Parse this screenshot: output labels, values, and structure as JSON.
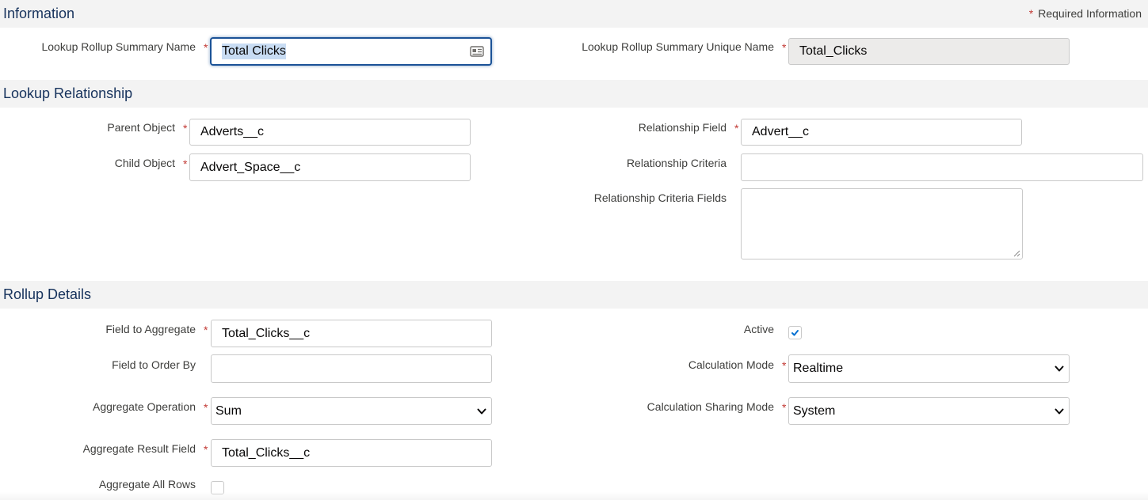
{
  "sections": {
    "information": {
      "title": "Information",
      "required_note": "Required Information",
      "required_star": "*"
    },
    "lookup_relationship": {
      "title": "Lookup Relationship"
    },
    "rollup_details": {
      "title": "Rollup Details"
    }
  },
  "fields": {
    "summary_name": {
      "label": "Lookup Rollup Summary Name",
      "value": "Total Clicks",
      "required": true
    },
    "unique_name": {
      "label": "Lookup Rollup Summary Unique Name",
      "value": "Total_Clicks",
      "required": true
    },
    "parent_object": {
      "label": "Parent Object",
      "value": "Adverts__c",
      "required": true
    },
    "child_object": {
      "label": "Child Object",
      "value": "Advert_Space__c",
      "required": true
    },
    "relationship_field": {
      "label": "Relationship Field",
      "value": "Advert__c",
      "required": true
    },
    "relationship_criteria": {
      "label": "Relationship Criteria",
      "value": ""
    },
    "relationship_criteria_fields": {
      "label": "Relationship Criteria Fields",
      "value": ""
    },
    "field_to_aggregate": {
      "label": "Field to Aggregate",
      "value": "Total_Clicks__c",
      "required": true
    },
    "field_to_order_by": {
      "label": "Field to Order By",
      "value": ""
    },
    "aggregate_operation": {
      "label": "Aggregate Operation",
      "selected": "Sum",
      "required": true
    },
    "aggregate_result_field": {
      "label": "Aggregate Result Field",
      "value": "Total_Clicks__c",
      "required": true
    },
    "aggregate_all_rows": {
      "label": "Aggregate All Rows",
      "checked": false
    },
    "active": {
      "label": "Active",
      "checked": true
    },
    "calculation_mode": {
      "label": "Calculation Mode",
      "selected": "Realtime",
      "required": true
    },
    "calculation_sharing_mode": {
      "label": "Calculation Sharing Mode",
      "selected": "System",
      "required": true
    }
  },
  "icons": {
    "card": "contact-card-icon",
    "chevron": "chevron-down-icon",
    "check": "checkmark-icon",
    "resize": "resize-handle-icon"
  },
  "colors": {
    "section_title": "#16325c",
    "required_star": "#c23934",
    "focus_border": "#1b5297",
    "checkbox_check": "#0070d2",
    "section_bg": "#f3f3f3"
  }
}
